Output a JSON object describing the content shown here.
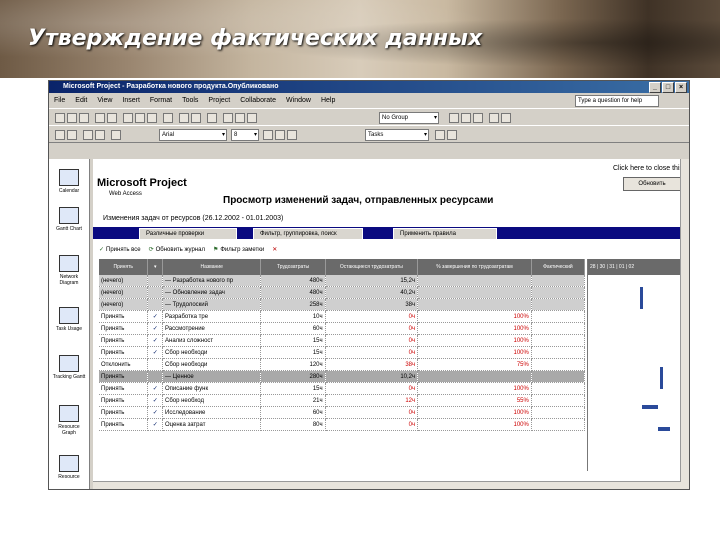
{
  "slide_title": "Утверждение фактических данных",
  "window": {
    "title": "Microsoft Project - Разработка нового продукта.Опубликовано",
    "controls": [
      "_",
      "□",
      "×"
    ]
  },
  "menu": [
    "File",
    "Edit",
    "View",
    "Insert",
    "Format",
    "Tools",
    "Project",
    "Collaborate",
    "Window",
    "Help"
  ],
  "help_placeholder": "Type a question for help",
  "toolbar": {
    "group_combo": "No Group",
    "font_combo": "Arial",
    "size_combo": "8",
    "tasks_combo": "Tasks"
  },
  "view_bar": [
    {
      "label": "Calendar",
      "icon": "calendar-icon"
    },
    {
      "label": "Gantt Chart",
      "icon": "gantt-chart-icon"
    },
    {
      "label": "Network Diagram",
      "icon": "network-diagram-icon"
    },
    {
      "label": "Task Usage",
      "icon": "task-usage-icon"
    },
    {
      "label": "Tracking Gantt",
      "icon": "tracking-gantt-icon"
    },
    {
      "label": "Resource Graph",
      "icon": "resource-graph-icon"
    },
    {
      "label": "Resource",
      "icon": "resource-sheet-icon"
    }
  ],
  "browser": {
    "click_hint": "Click here to close this",
    "logo": "Microsoft Project",
    "logo_sub": "Web Access",
    "page_title": "Просмотр изменений задач, отправленных ресурсами",
    "signout": "Обновить",
    "subtitle": "Изменения задач от ресурсов (26.12.2002 - 01.01.2003)",
    "tabs": [
      "Различные проверки",
      "Фильтр, группировка, поиск",
      "Применить правила"
    ],
    "actions": [
      "Принять все",
      "Обновить журнал",
      "Фильтр заметки"
    ],
    "columns": [
      "Принять",
      "",
      "Название",
      "Трудозатраты",
      "Остающиеся трудозатраты",
      "% завершения по трудозатратам",
      "Фактический"
    ],
    "rows": [
      {
        "accept": "(нечего)",
        "check": "",
        "name": "— Разработка нового пр",
        "work": "480ч",
        "remain": "15,2ч",
        "pct": "",
        "style": "g"
      },
      {
        "accept": "(нечего)",
        "check": "",
        "name": "— Обновление задач",
        "work": "480ч",
        "remain": "40,2ч",
        "pct": "",
        "style": "g"
      },
      {
        "accept": "(нечего)",
        "check": "",
        "name": "— Трудолоский",
        "work": "258ч",
        "remain": "38ч",
        "pct": "",
        "style": "g"
      },
      {
        "accept": "Принять",
        "check": "✓",
        "name": "Разработка тре",
        "work": "10ч",
        "remain": "0ч",
        "pct": "100%",
        "style": "w"
      },
      {
        "accept": "Принять",
        "check": "✓",
        "name": "Рассмотрение",
        "work": "60ч",
        "remain": "0ч",
        "pct": "100%",
        "style": "w"
      },
      {
        "accept": "Принять",
        "check": "✓",
        "name": "Анализ сложност",
        "work": "15ч",
        "remain": "0ч",
        "pct": "100%",
        "style": "w"
      },
      {
        "accept": "Принять",
        "check": "✓",
        "name": "Сбор необходи",
        "work": "15ч",
        "remain": "0ч",
        "pct": "100%",
        "style": "w"
      },
      {
        "accept": "Отклонить",
        "check": "",
        "name": "Сбор необходи",
        "work": "120ч",
        "remain": "38ч",
        "pct": "75%",
        "style": "w"
      },
      {
        "accept": "Принять",
        "check": "",
        "name": "— Ценное",
        "work": "280ч",
        "remain": "10,2ч",
        "pct": "",
        "style": "sel"
      },
      {
        "accept": "Принять",
        "check": "✓",
        "name": "Описание функ",
        "work": "15ч",
        "remain": "0ч",
        "pct": "100%",
        "style": "w"
      },
      {
        "accept": "Принять",
        "check": "✓",
        "name": "Сбор необход",
        "work": "21ч",
        "remain": "12ч",
        "pct": "55%",
        "style": "w"
      },
      {
        "accept": "Принять",
        "check": "✓",
        "name": "Исследование",
        "work": "60ч",
        "remain": "0ч",
        "pct": "100%",
        "style": "w"
      },
      {
        "accept": "Принять",
        "check": "✓",
        "name": "Оценка затрат",
        "work": "80ч",
        "remain": "0ч",
        "pct": "100%",
        "style": "w"
      }
    ]
  }
}
